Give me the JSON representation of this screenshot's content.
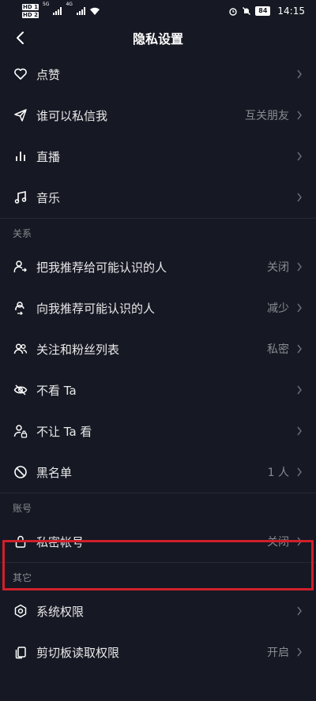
{
  "status_bar": {
    "hd1": "HD 1",
    "hd2": "HD 2",
    "net1": "5G",
    "net2": "4G",
    "battery": "84",
    "time": "14:15"
  },
  "nav": {
    "title": "隐私设置"
  },
  "rows_top": [
    {
      "label": "点赞",
      "value": "",
      "icon": "heart-icon"
    },
    {
      "label": "谁可以私信我",
      "value": "互关朋友",
      "icon": "send-icon"
    },
    {
      "label": "直播",
      "value": "",
      "icon": "live-bars-icon"
    },
    {
      "label": "音乐",
      "value": "",
      "icon": "music-note-icon"
    }
  ],
  "sections": {
    "relation": "关系",
    "account": "账号",
    "other": "其它"
  },
  "rows_relation": [
    {
      "label": "把我推荐给可能认识的人",
      "value": "关闭",
      "icon": "user-share-icon"
    },
    {
      "label": "向我推荐可能认识的人",
      "value": "减少",
      "icon": "user-recommend-icon"
    },
    {
      "label": "关注和粉丝列表",
      "value": "私密",
      "icon": "users-icon"
    },
    {
      "label": "不看 Ta",
      "value": "",
      "icon": "eye-off-icon"
    },
    {
      "label": "不让 Ta 看",
      "value": "",
      "icon": "user-lock-icon"
    },
    {
      "label": "黑名单",
      "value": "1 人",
      "icon": "block-icon"
    }
  ],
  "rows_account": [
    {
      "label": "私密帐号",
      "value": "关闭",
      "icon": "lock-icon"
    }
  ],
  "rows_other": [
    {
      "label": "系统权限",
      "value": "",
      "icon": "hexagon-settings-icon"
    },
    {
      "label": "剪切板读取权限",
      "value": "开启",
      "icon": "clipboard-icon"
    }
  ],
  "colors": {
    "background": "#161823",
    "highlight_border": "#d0202b",
    "secondary_text": "#8a8b91"
  }
}
